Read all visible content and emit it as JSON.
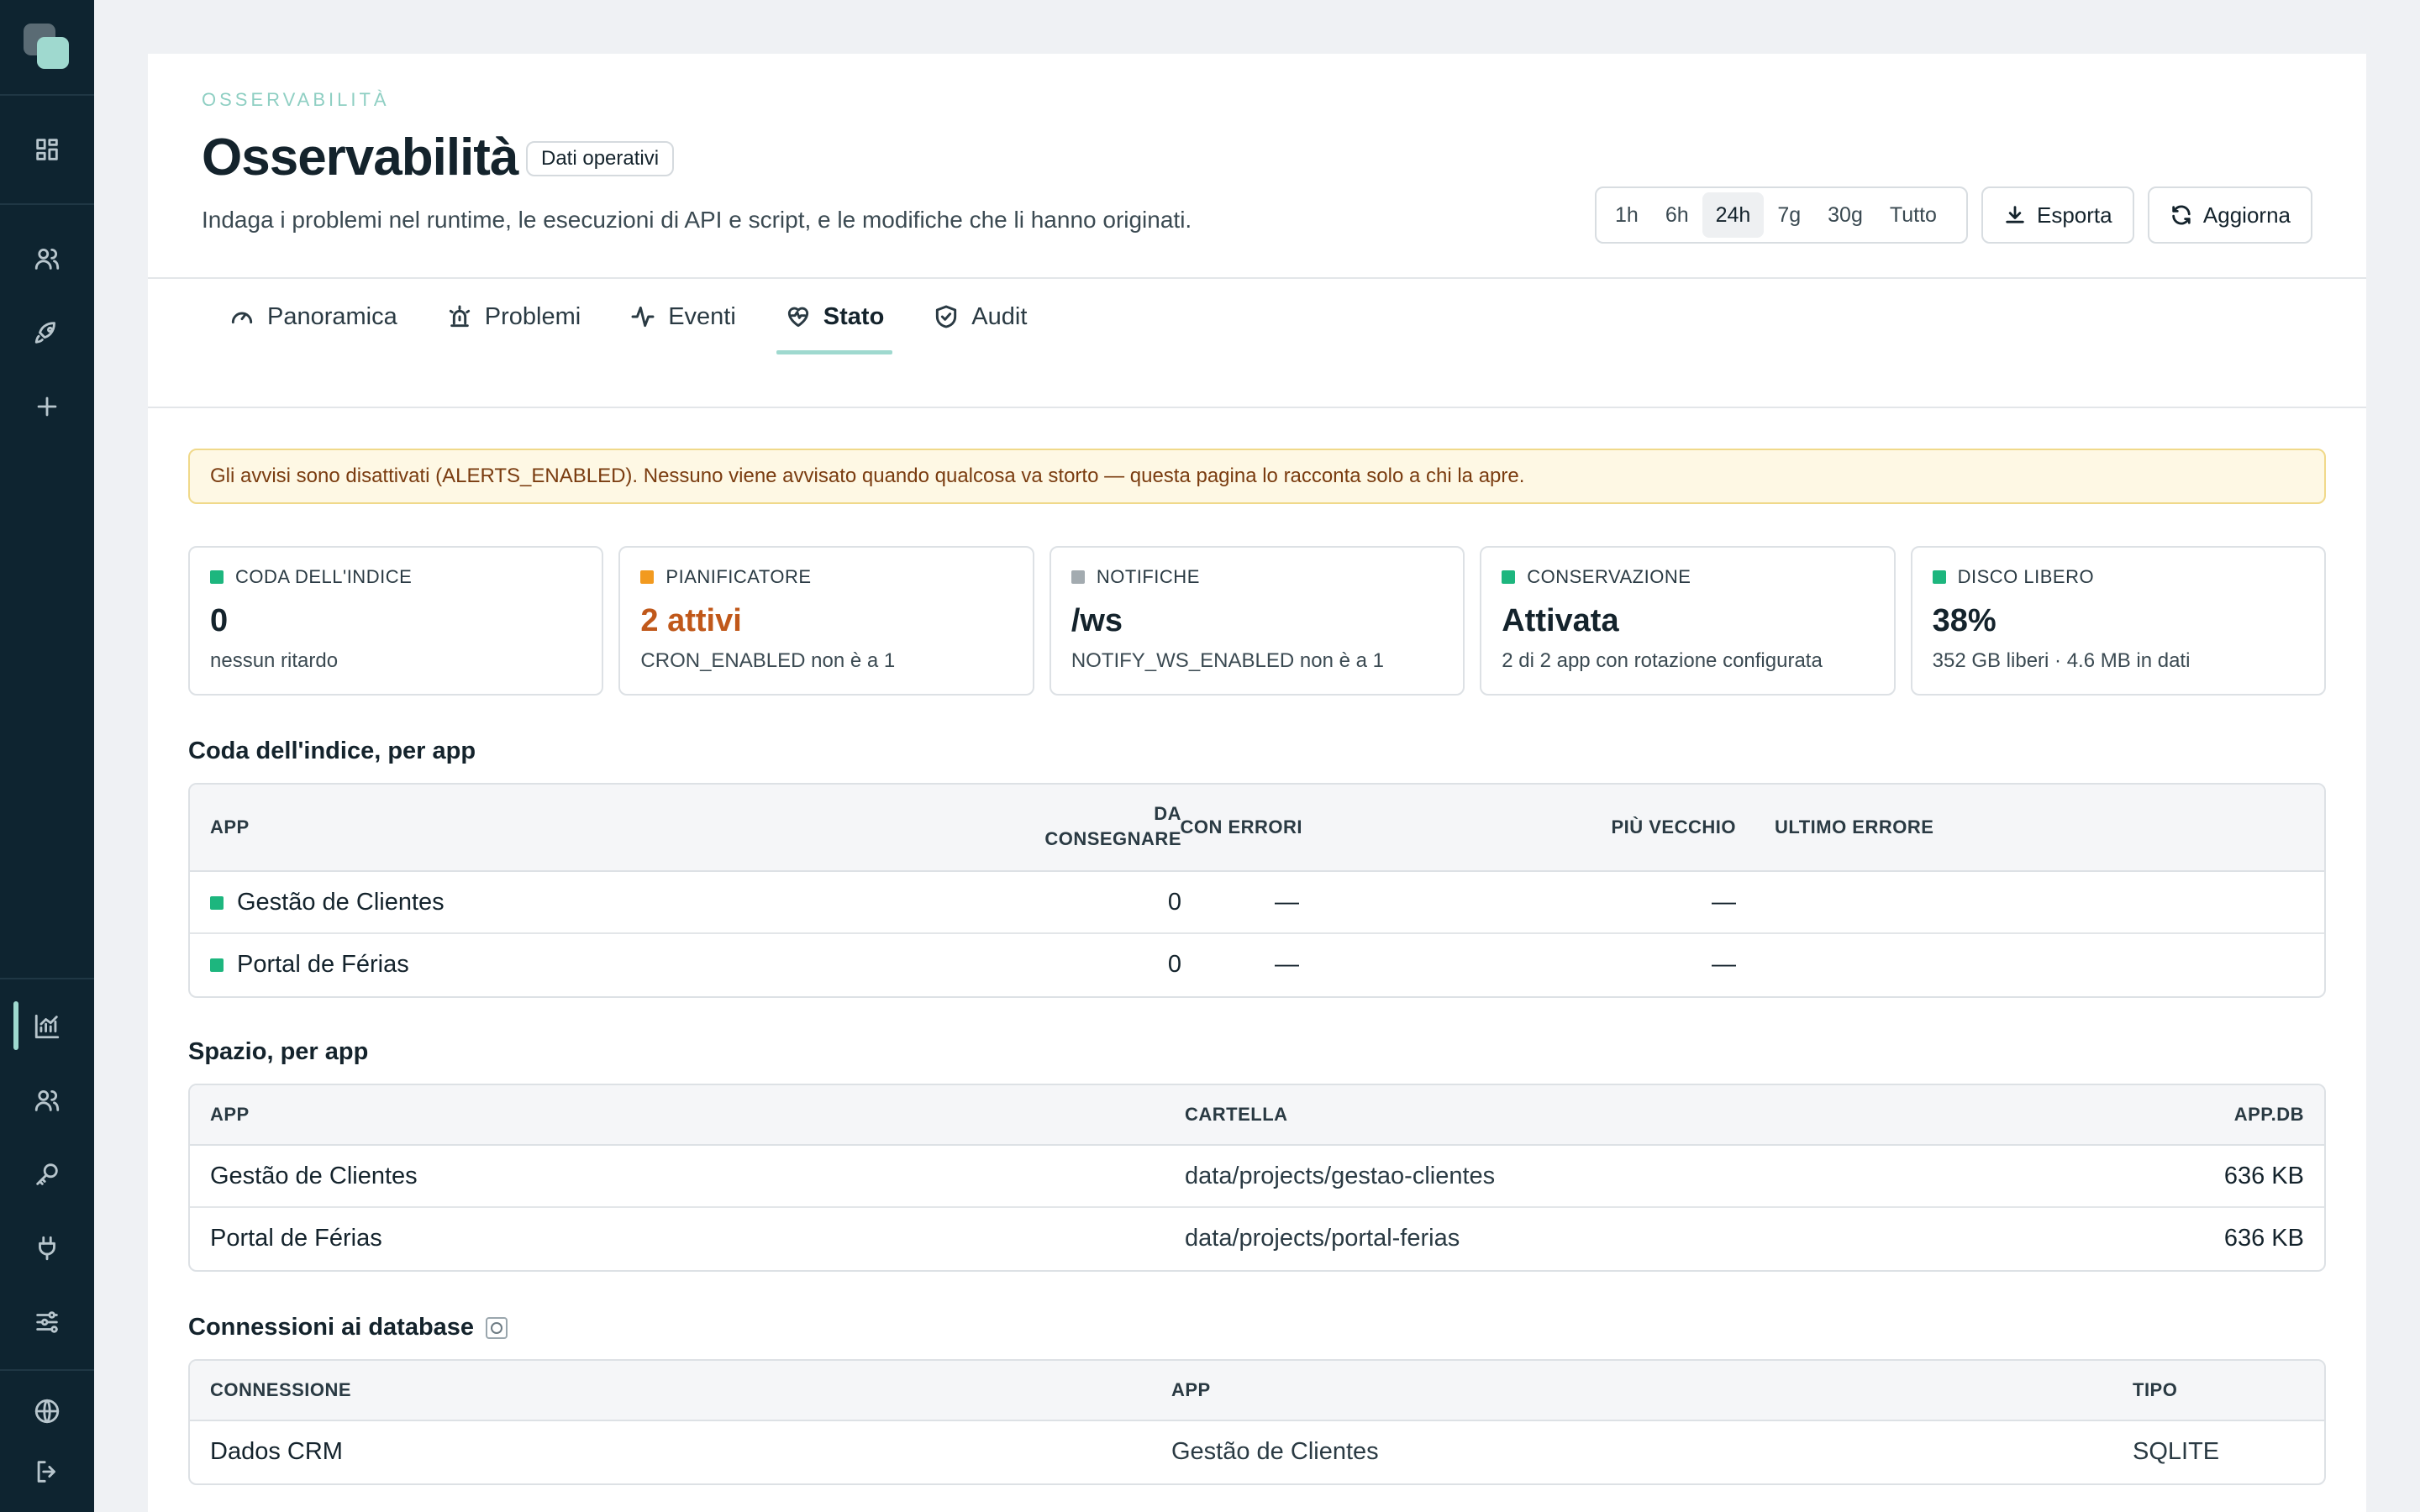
{
  "header": {
    "eyebrow": "OSSERVABILITÀ",
    "title": "Osservabilità",
    "badge": "Dati operativi",
    "subtitle": "Indaga i problemi nel runtime, le esecuzioni di API e script, e le modifiche che li hanno originati.",
    "ranges": [
      "1h",
      "6h",
      "24h",
      "7g",
      "30g",
      "Tutto"
    ],
    "active_range": "24h",
    "export_label": "Esporta",
    "refresh_label": "Aggiorna"
  },
  "tabs": [
    {
      "label": "Panoramica",
      "icon": "gauge-icon"
    },
    {
      "label": "Problemi",
      "icon": "siren-icon"
    },
    {
      "label": "Eventi",
      "icon": "activity-icon"
    },
    {
      "label": "Stato",
      "icon": "heart-pulse-icon",
      "active": true
    },
    {
      "label": "Audit",
      "icon": "shield-check-icon"
    }
  ],
  "alert": "Gli avvisi sono disattivati (ALERTS_ENABLED). Nessuno viene avvisato quando qualcosa va storto — questa pagina lo racconta solo a chi la apre.",
  "stats": [
    {
      "label": "CODA DELL'INDICE",
      "value": "0",
      "sub": "nessun ritardo",
      "color": "#1db67e"
    },
    {
      "label": "PIANIFICATORE",
      "value": "2 attivi",
      "sub": "CRON_ENABLED non è a 1",
      "color": "#f29a1f",
      "warn": true
    },
    {
      "label": "NOTIFICHE",
      "value": "/ws",
      "sub": "NOTIFY_WS_ENABLED non è a 1",
      "color": "#a3abb0"
    },
    {
      "label": "CONSERVAZIONE",
      "value": "Attivata",
      "sub": "2 di 2 app con rotazione configurata",
      "color": "#1db67e"
    },
    {
      "label": "DISCO LIBERO",
      "value": "38%",
      "sub": "352 GB liberi · 4.6 MB in dati",
      "color": "#1db67e"
    }
  ],
  "queue": {
    "title": "Coda dell'indice, per app",
    "headers": {
      "app": "APP",
      "pending_1": "DA",
      "pending_2": "CONSEGNARE",
      "errors": "CON ERRORI",
      "oldest": "PIÙ VECCHIO",
      "last_error": "ULTIMO ERRORE"
    },
    "rows": [
      {
        "app": "Gestão de Clientes",
        "pending": "0",
        "errors": "—",
        "oldest": "—",
        "last_error": ""
      },
      {
        "app": "Portal de Férias",
        "pending": "0",
        "errors": "—",
        "oldest": "—",
        "last_error": ""
      }
    ]
  },
  "space": {
    "title": "Spazio, per app",
    "headers": {
      "app": "APP",
      "folder": "CARTELLA",
      "db": "APP.DB"
    },
    "rows": [
      {
        "app": "Gestão de Clientes",
        "folder": "data/projects/gestao-clientes",
        "db": "636 KB"
      },
      {
        "app": "Portal de Férias",
        "folder": "data/projects/portal-ferias",
        "db": "636 KB"
      }
    ]
  },
  "connections": {
    "title": "Connessioni ai database",
    "headers": {
      "connection": "CONNESSIONE",
      "app": "APP",
      "type": "TIPO"
    },
    "rows": [
      {
        "connection": "Dados CRM",
        "app": "Gestão de Clientes",
        "type": "SQLITE"
      }
    ]
  },
  "colors": {
    "accent": "#9fd9cf",
    "sidebar": "#0e2430",
    "ok": "#1db67e",
    "warn": "#f29a1f"
  }
}
